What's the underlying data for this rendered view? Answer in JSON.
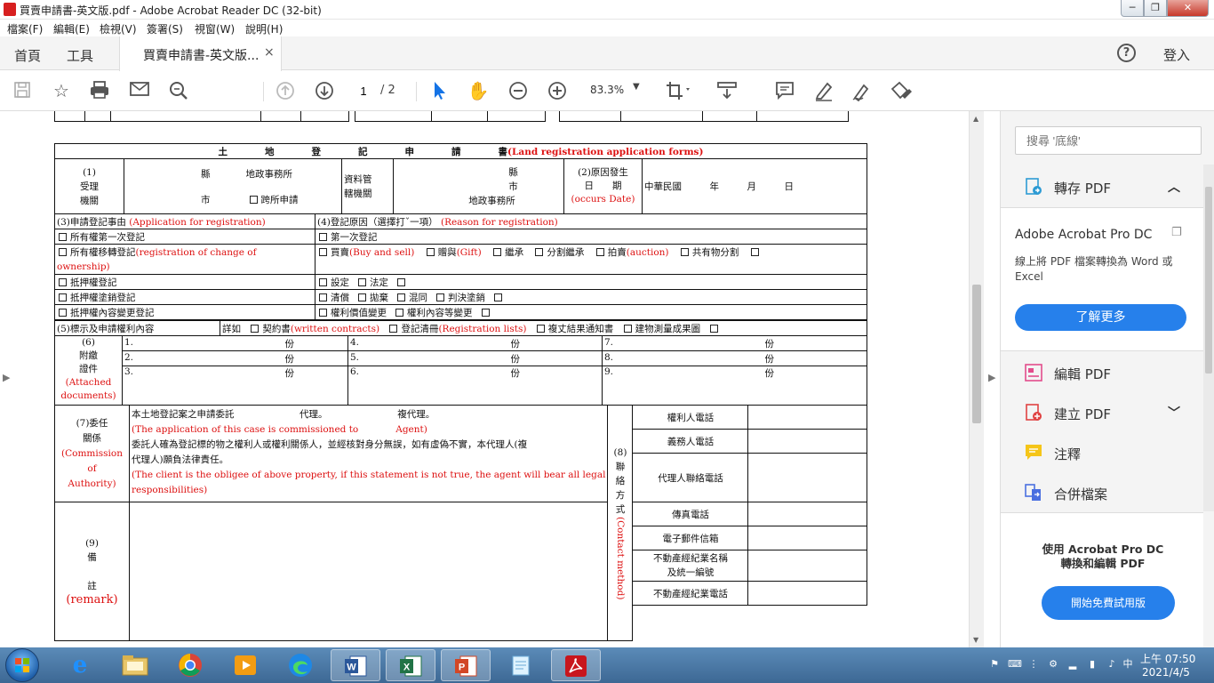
{
  "window": {
    "title": "買賣申請書-英文版.pdf - Adobe Acrobat Reader DC (32-bit)",
    "min": "─",
    "max": "❐",
    "close": "✕"
  },
  "menu": [
    "檔案(F)",
    "編輯(E)",
    "檢視(V)",
    "簽署(S)",
    "視窗(W)",
    "說明(H)"
  ],
  "tabs": {
    "home": "首頁",
    "tools": "工具",
    "document": "買賣申請書-英文版...",
    "close": "×",
    "help": "?",
    "signin": "登入"
  },
  "toolbar": {
    "page_current": "1",
    "page_total": "/ 2",
    "zoom": "83.3%",
    "icons": [
      "save-icon",
      "bookmark-star-icon",
      "print-icon",
      "email-icon",
      "search-zoom-icon",
      "page-up-icon",
      "page-down-icon",
      "select-cursor-icon",
      "hand-icon",
      "zoom-out-icon",
      "zoom-in-icon",
      "crop-icon",
      "scroll-mode-icon",
      "comment-icon",
      "highlight-icon",
      "sign-icon",
      "fill-sign-icon"
    ]
  },
  "form": {
    "title_zh": "土　　　　地　　　　登　　　　記　　　　申　　　　請　　　　書",
    "title_en": "(Land registration application forms)",
    "r1": {
      "label1": "(1)",
      "label2": "受理",
      "label3": "機關",
      "county": "縣",
      "office": "地政事務所",
      "city": "市",
      "cross": "跨所申請",
      "jurisdiction1": "資料管",
      "jurisdiction2": "轄機關",
      "county2": "縣",
      "city2": "市",
      "office2": "地政事務所",
      "date_label1": "(2)原因發生",
      "date_label2": "日　　期",
      "date_label_en": "(occurs Date)",
      "date_value": "中華民國　　　年　　　月　　　日"
    },
    "r3": {
      "h3": "(3)申請登記事由",
      "h3_en": "(Application for registration)",
      "h4": "(4)登記原因（選擇打ˇ一項）",
      "h4_en": "(Reason for registration)",
      "left": [
        "所有權第一次登記",
        "所有權移轉登記",
        "抵押權登記",
        "抵押權塗銷登記",
        "抵押權內容變更登記"
      ],
      "left_en": "(registration of change of",
      "left_en2": "ownership)",
      "right_first": "第一次登記",
      "sale": "買賣",
      "sale_en": "(Buy and sell)",
      "gift": "贈與",
      "gift_en": "(Gift)",
      "inherit": "繼承",
      "split_inherit": "分割繼承",
      "auction": "拍賣",
      "auction_en": "(auction)",
      "co_split": "共有物分割",
      "set": "設定",
      "legal": "法定",
      "repay": "清償",
      "abandon": "拋棄",
      "merge": "混同",
      "judgment": "判決塗銷",
      "value_change": "權利價值變更",
      "content_change": "權利內容等變更"
    },
    "r5": {
      "h5": "(5)標示及申請權利內容",
      "detail": "詳如",
      "contract": "契約書",
      "contract_en": "(written contracts)",
      "list": "登記清冊",
      "list_en": "(Registration lists)",
      "survey": "複丈結果通知書",
      "building": "建物測量成果圖"
    },
    "r6": {
      "label1": "(6)",
      "label2": "附繳",
      "label3": "證件",
      "label_en1": "(Attached",
      "label_en2": "documents)",
      "items": [
        "1.",
        "2.",
        "3.",
        "4.",
        "5.",
        "6.",
        "7.",
        "8.",
        "9."
      ],
      "unit": "份"
    },
    "r7": {
      "label1": "(7)委任",
      "label2": "關係",
      "label_en1": "(Commission",
      "label_en2": "of",
      "label_en3": "Authority)",
      "line1": "本土地登記案之申請委託　　　　　　　代理。　　　　　　　　複代理。",
      "line2_en": "(The application of this case is commissioned to　　　　Agent)",
      "line3": "委託人確為登記標的物之權利人或權利關係人，並經核對身分無誤，如有虛偽不實，本代理人(複",
      "line4": "代理人)願負法律責任。",
      "line5_en": "(The client is the obligee of above property, if this statement is not true, the agent will bear all legal",
      "line6_en": "responsibilities)"
    },
    "r8": {
      "label1": "(8)",
      "label2": "聯",
      "label3": "絡",
      "label4": "方",
      "label5": "式",
      "label_en": "(Contact  method)",
      "fields": [
        "權利人電話",
        "義務人電話",
        "代理人聯絡電話",
        "傳真電話",
        "電子郵件信箱",
        "不動產經紀業名稱",
        "及統一編號",
        "不動產經紀業電話"
      ]
    },
    "r9": {
      "label1": "(9)",
      "label2": "備",
      "label3": "註",
      "label_en": "(remark)"
    }
  },
  "right_panel": {
    "search_placeholder": "搜尋 '底線'",
    "export_pdf": "轉存 PDF",
    "product": "Adobe Acrobat Pro DC",
    "desc": "線上將 PDF 檔案轉換為 Word 或 Excel",
    "learn_more": "了解更多",
    "edit_pdf": "編輯 PDF",
    "create_pdf": "建立 PDF",
    "comment": "注釋",
    "combine": "合併檔案",
    "bottom_text1": "使用 Acrobat Pro DC",
    "bottom_text2": "轉換和編輯 PDF",
    "trial": "開始免費試用版"
  },
  "taskbar": {
    "time": "上午 07:50",
    "date": "2021/4/5",
    "apps": [
      "ie-icon",
      "file-explorer-icon",
      "chrome-icon",
      "media-player-icon",
      "edge-icon",
      "word-icon",
      "excel-icon",
      "powerpoint-icon",
      "notepad-icon",
      "acrobat-icon"
    ]
  },
  "colors": {
    "accent": "#2680eb",
    "form_red": "#dd1111",
    "taskbar": "#4a7aa8"
  }
}
